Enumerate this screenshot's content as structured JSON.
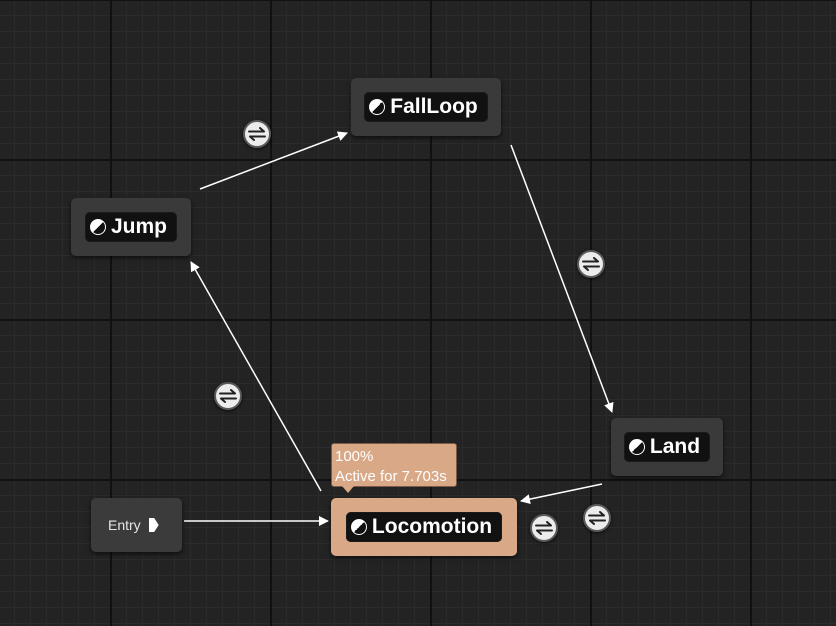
{
  "graph": {
    "entry": {
      "label": "Entry"
    },
    "states": {
      "falloop": {
        "label": "FallLoop"
      },
      "jump": {
        "label": "Jump"
      },
      "land": {
        "label": "Land"
      },
      "locomotion": {
        "label": "Locomotion"
      }
    },
    "active_tooltip": {
      "weight": "100%",
      "status": "Active for 7.703s"
    }
  },
  "colors": {
    "canvas_background": "#232323",
    "state_background": "#3a3a3a",
    "active_state_background": "#d9a886",
    "state_label_background": "#111111",
    "wire": "#ffffff",
    "transition_icon": "#ececec"
  },
  "icons": {
    "state": "state-node-icon",
    "transition": "transition-rule-icon",
    "entry_pin": "exec-pin-icon"
  }
}
